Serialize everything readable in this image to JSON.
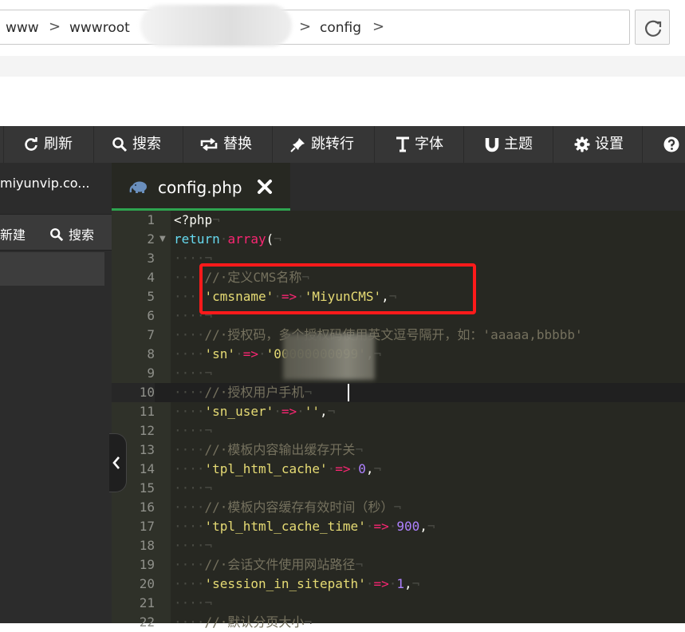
{
  "breadcrumb": {
    "items": [
      "www",
      "wwwroot",
      "config"
    ],
    "separator": ">"
  },
  "toolbar": {
    "buttons": [
      {
        "label": "刷新",
        "icon": "refresh-icon"
      },
      {
        "label": "搜索",
        "icon": "search-icon"
      },
      {
        "label": "替换",
        "icon": "replace-icon"
      },
      {
        "label": "跳转行",
        "icon": "pin-icon"
      },
      {
        "label": "字体",
        "icon": "text-icon"
      },
      {
        "label": "主题",
        "icon": "magnet-icon"
      },
      {
        "label": "设置",
        "icon": "gear-icon"
      },
      {
        "label": "",
        "icon": "help-icon"
      }
    ]
  },
  "sidebar": {
    "site_name": "miyunvip.co...",
    "new_label": "新建",
    "search_label": "搜索"
  },
  "tabs": [
    {
      "title": "config.php",
      "icon": "php-elephant-icon",
      "active": true
    }
  ],
  "editor": {
    "current_line": 10,
    "colors": {
      "background": "#272822",
      "keyword": "#66d9ef",
      "operator": "#f92672",
      "string": "#e6db74",
      "number": "#ae81ff",
      "comment": "#75715e",
      "highlight_box": "#ff1a1a"
    },
    "lines": [
      {
        "n": 1,
        "fold": false,
        "tokens": [
          [
            "plain",
            "<?php"
          ],
          [
            "ws",
            "¬"
          ]
        ]
      },
      {
        "n": 2,
        "fold": true,
        "tokens": [
          [
            "kw",
            "return"
          ],
          [
            "ws",
            "·"
          ],
          [
            "op",
            "array"
          ],
          [
            "plain",
            "("
          ],
          [
            "ws",
            "¬"
          ]
        ]
      },
      {
        "n": 3,
        "fold": false,
        "tokens": [
          [
            "ws",
            "····¬"
          ]
        ]
      },
      {
        "n": 4,
        "fold": false,
        "tokens": [
          [
            "ws",
            "····"
          ],
          [
            "cm",
            "//·定义CMS名称"
          ],
          [
            "ws",
            "¬"
          ]
        ]
      },
      {
        "n": 5,
        "fold": false,
        "tokens": [
          [
            "ws",
            "····"
          ],
          [
            "str",
            "'cmsname'"
          ],
          [
            "ws",
            "·"
          ],
          [
            "op",
            "=>"
          ],
          [
            "ws",
            "·"
          ],
          [
            "str",
            "'MiyunCMS'"
          ],
          [
            "plain",
            ","
          ],
          [
            "ws",
            "¬"
          ]
        ]
      },
      {
        "n": 6,
        "fold": false,
        "tokens": [
          [
            "ws",
            "····¬"
          ]
        ]
      },
      {
        "n": 7,
        "fold": false,
        "tokens": [
          [
            "ws",
            "····"
          ],
          [
            "cm",
            "//·授权码，多个授权码使用英文逗号隔开，如：'aaaaa,bbbbb'"
          ]
        ]
      },
      {
        "n": 8,
        "fold": false,
        "tokens": [
          [
            "ws",
            "····"
          ],
          [
            "str",
            "'sn'"
          ],
          [
            "ws",
            "·"
          ],
          [
            "op",
            "=>"
          ],
          [
            "ws",
            "·"
          ],
          [
            "str",
            "'00000000099'"
          ],
          [
            "plain",
            ","
          ],
          [
            "ws",
            "¬"
          ]
        ]
      },
      {
        "n": 9,
        "fold": false,
        "tokens": [
          [
            "ws",
            "····¬"
          ]
        ]
      },
      {
        "n": 10,
        "fold": false,
        "tokens": [
          [
            "ws",
            "····"
          ],
          [
            "cm",
            "//·授权用户手机"
          ],
          [
            "ws",
            "¬"
          ]
        ]
      },
      {
        "n": 11,
        "fold": false,
        "tokens": [
          [
            "ws",
            "····"
          ],
          [
            "str",
            "'sn_user'"
          ],
          [
            "ws",
            "·"
          ],
          [
            "op",
            "=>"
          ],
          [
            "ws",
            "·"
          ],
          [
            "str",
            "''"
          ],
          [
            "plain",
            ","
          ],
          [
            "ws",
            "¬"
          ]
        ]
      },
      {
        "n": 12,
        "fold": false,
        "tokens": [
          [
            "ws",
            "····¬"
          ]
        ]
      },
      {
        "n": 13,
        "fold": false,
        "tokens": [
          [
            "ws",
            "····"
          ],
          [
            "cm",
            "//·模板内容输出缓存开关"
          ],
          [
            "ws",
            "¬"
          ]
        ]
      },
      {
        "n": 14,
        "fold": false,
        "tokens": [
          [
            "ws",
            "····"
          ],
          [
            "str",
            "'tpl_html_cache'"
          ],
          [
            "ws",
            "·"
          ],
          [
            "op",
            "=>"
          ],
          [
            "ws",
            "·"
          ],
          [
            "num",
            "0"
          ],
          [
            "plain",
            ","
          ],
          [
            "ws",
            "¬"
          ]
        ]
      },
      {
        "n": 15,
        "fold": false,
        "tokens": [
          [
            "ws",
            "····¬"
          ]
        ]
      },
      {
        "n": 16,
        "fold": false,
        "tokens": [
          [
            "ws",
            "····"
          ],
          [
            "cm",
            "//·模板内容缓存有效时间（秒）"
          ],
          [
            "ws",
            "¬"
          ]
        ]
      },
      {
        "n": 17,
        "fold": false,
        "tokens": [
          [
            "ws",
            "····"
          ],
          [
            "str",
            "'tpl_html_cache_time'"
          ],
          [
            "ws",
            "·"
          ],
          [
            "op",
            "=>"
          ],
          [
            "ws",
            "·"
          ],
          [
            "num",
            "900"
          ],
          [
            "plain",
            ","
          ],
          [
            "ws",
            "¬"
          ]
        ]
      },
      {
        "n": 18,
        "fold": false,
        "tokens": [
          [
            "ws",
            "····¬"
          ]
        ]
      },
      {
        "n": 19,
        "fold": false,
        "tokens": [
          [
            "ws",
            "····"
          ],
          [
            "cm",
            "//·会话文件使用网站路径"
          ],
          [
            "ws",
            "¬"
          ]
        ]
      },
      {
        "n": 20,
        "fold": false,
        "tokens": [
          [
            "ws",
            "····"
          ],
          [
            "str",
            "'session_in_sitepath'"
          ],
          [
            "ws",
            "·"
          ],
          [
            "op",
            "=>"
          ],
          [
            "ws",
            "·"
          ],
          [
            "num",
            "1"
          ],
          [
            "plain",
            ","
          ],
          [
            "ws",
            "¬"
          ]
        ]
      },
      {
        "n": 21,
        "fold": false,
        "tokens": [
          [
            "ws",
            "····¬"
          ]
        ]
      },
      {
        "n": 22,
        "fold": false,
        "tokens": [
          [
            "ws",
            "····"
          ],
          [
            "cm",
            "//·默认分页大小"
          ],
          [
            "ws",
            "¬"
          ]
        ]
      }
    ]
  }
}
